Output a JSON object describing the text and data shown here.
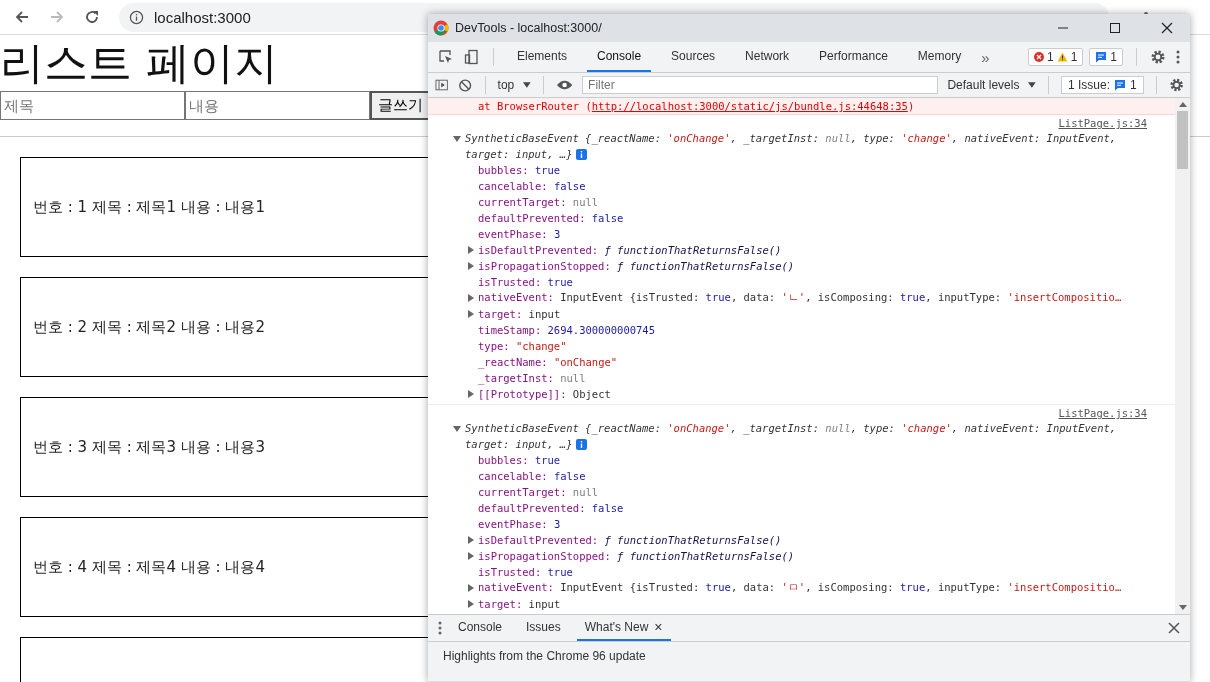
{
  "browser": {
    "address": "localhost:3000",
    "back_disabled": false,
    "forward_disabled": true
  },
  "page": {
    "title": "리스트 페이지",
    "form": {
      "title_placeholder": "제목",
      "content_placeholder": "내용",
      "submit": "글쓰기"
    },
    "posts": [
      {
        "kind": "full",
        "text": "번호 : 1 제목 : 제목1 내용 : 내용1"
      },
      {
        "kind": "full",
        "text": "번호 : 2 제목 : 제목2 내용 : 내용2"
      },
      {
        "kind": "full",
        "text": "번호 : 3 제목 : 제목3 내용 : 내용3"
      },
      {
        "kind": "full",
        "text": "번호 : 4 제목 : 제목4 내용 : 내용4"
      },
      {
        "kind": "cut_off"
      }
    ]
  },
  "devtools": {
    "title": "DevTools - localhost:3000/",
    "tabs": [
      {
        "label": "Elements",
        "selected": false
      },
      {
        "label": "Console",
        "selected": true
      },
      {
        "label": "Sources",
        "selected": false
      },
      {
        "label": "Network",
        "selected": false
      },
      {
        "label": "Performance",
        "selected": false
      },
      {
        "label": "Memory",
        "selected": false
      }
    ],
    "more_tabs": "»",
    "counters": {
      "errors": "1",
      "warnings": "1",
      "messages": "1"
    },
    "console_toolbar": {
      "context": "top",
      "filter_placeholder": "Filter",
      "levels": "Default levels",
      "issues_label": "1 Issue:",
      "issues_count": "1"
    },
    "error_line": {
      "prefix": "at BrowserRouter (",
      "link": "http://localhost:3000/static/js/bundle.js:44648:35",
      "suffix": ")"
    },
    "events": [
      {
        "source": "ListPage.js:34",
        "expanded": true,
        "header": [
          {
            "text": "SyntheticBaseEvent {_reactName: ",
            "kind": "plain"
          },
          {
            "text": "'onChange'",
            "kind": "string"
          },
          {
            "text": ", _targetInst: ",
            "kind": "plain"
          },
          {
            "text": "null",
            "kind": "null"
          },
          {
            "text": ", type: ",
            "kind": "plain"
          },
          {
            "text": "'change'",
            "kind": "string"
          },
          {
            "text": ", nativeEvent: InputEvent,",
            "kind": "plain"
          }
        ],
        "header_cont": "target: input, …}",
        "props": [
          {
            "key": "bubbles:",
            "expandable": false,
            "value": [
              {
                "text": "true",
                "kind": "keyword"
              }
            ]
          },
          {
            "key": "cancelable:",
            "expandable": false,
            "value": [
              {
                "text": "false",
                "kind": "keyword"
              }
            ]
          },
          {
            "key": "currentTarget:",
            "expandable": false,
            "value": [
              {
                "text": "null",
                "kind": "null"
              }
            ]
          },
          {
            "key": "defaultPrevented:",
            "expandable": false,
            "value": [
              {
                "text": "false",
                "kind": "keyword"
              }
            ]
          },
          {
            "key": "eventPhase:",
            "expandable": false,
            "value": [
              {
                "text": "3",
                "kind": "keyword"
              }
            ]
          },
          {
            "key": "isDefaultPrevented:",
            "expandable": true,
            "value": [
              {
                "text": "ƒ functionThatReturnsFalse()",
                "kind": "function"
              }
            ]
          },
          {
            "key": "isPropagationStopped:",
            "expandable": true,
            "value": [
              {
                "text": "ƒ functionThatReturnsFalse()",
                "kind": "function"
              }
            ]
          },
          {
            "key": "isTrusted:",
            "expandable": false,
            "value": [
              {
                "text": "true",
                "kind": "keyword"
              }
            ]
          },
          {
            "key": "nativeEvent:",
            "expandable": true,
            "value": [
              {
                "text": "InputEvent {isTrusted: ",
                "kind": "plain"
              },
              {
                "text": "true",
                "kind": "keyword"
              },
              {
                "text": ", data: ",
                "kind": "plain"
              },
              {
                "text": "'ㄴ'",
                "kind": "string"
              },
              {
                "text": ", isComposing: ",
                "kind": "plain"
              },
              {
                "text": "true",
                "kind": "keyword"
              },
              {
                "text": ", inputType: ",
                "kind": "plain"
              },
              {
                "text": "'insertCompositio…",
                "kind": "string"
              }
            ]
          },
          {
            "key": "target:",
            "expandable": true,
            "value": [
              {
                "text": "input",
                "kind": "plain"
              }
            ]
          },
          {
            "key": "timeStamp:",
            "expandable": false,
            "value": [
              {
                "text": "2694.300000000745",
                "kind": "keyword"
              }
            ]
          },
          {
            "key": "type:",
            "expandable": false,
            "value": [
              {
                "text": "\"change\"",
                "kind": "string"
              }
            ]
          },
          {
            "key": "_reactName:",
            "expandable": false,
            "value": [
              {
                "text": "\"onChange\"",
                "kind": "string"
              }
            ]
          },
          {
            "key": "_targetInst:",
            "expandable": false,
            "value": [
              {
                "text": "null",
                "kind": "null"
              }
            ]
          },
          {
            "key": "[[Prototype]]:",
            "expandable": true,
            "value": [
              {
                "text": "Object",
                "kind": "plain"
              }
            ]
          }
        ]
      },
      {
        "source": "ListPage.js:34",
        "expanded": true,
        "header": [
          {
            "text": "SyntheticBaseEvent {_reactName: ",
            "kind": "plain"
          },
          {
            "text": "'onChange'",
            "kind": "string"
          },
          {
            "text": ", _targetInst: ",
            "kind": "plain"
          },
          {
            "text": "null",
            "kind": "null"
          },
          {
            "text": ", type: ",
            "kind": "plain"
          },
          {
            "text": "'change'",
            "kind": "string"
          },
          {
            "text": ", nativeEvent: InputEvent,",
            "kind": "plain"
          }
        ],
        "header_cont": "target: input, …}",
        "props": [
          {
            "key": "bubbles:",
            "expandable": false,
            "value": [
              {
                "text": "true",
                "kind": "keyword"
              }
            ]
          },
          {
            "key": "cancelable:",
            "expandable": false,
            "value": [
              {
                "text": "false",
                "kind": "keyword"
              }
            ]
          },
          {
            "key": "currentTarget:",
            "expandable": false,
            "value": [
              {
                "text": "null",
                "kind": "null"
              }
            ]
          },
          {
            "key": "defaultPrevented:",
            "expandable": false,
            "value": [
              {
                "text": "false",
                "kind": "keyword"
              }
            ]
          },
          {
            "key": "eventPhase:",
            "expandable": false,
            "value": [
              {
                "text": "3",
                "kind": "keyword"
              }
            ]
          },
          {
            "key": "isDefaultPrevented:",
            "expandable": true,
            "value": [
              {
                "text": "ƒ functionThatReturnsFalse()",
                "kind": "function"
              }
            ]
          },
          {
            "key": "isPropagationStopped:",
            "expandable": true,
            "value": [
              {
                "text": "ƒ functionThatReturnsFalse()",
                "kind": "function"
              }
            ]
          },
          {
            "key": "isTrusted:",
            "expandable": false,
            "value": [
              {
                "text": "true",
                "kind": "keyword"
              }
            ]
          },
          {
            "key": "nativeEvent:",
            "expandable": true,
            "value": [
              {
                "text": "InputEvent {isTrusted: ",
                "kind": "plain"
              },
              {
                "text": "true",
                "kind": "keyword"
              },
              {
                "text": ", data: ",
                "kind": "plain"
              },
              {
                "text": "'ㅁ'",
                "kind": "string"
              },
              {
                "text": ", isComposing: ",
                "kind": "plain"
              },
              {
                "text": "true",
                "kind": "keyword"
              },
              {
                "text": ", inputType: ",
                "kind": "plain"
              },
              {
                "text": "'insertCompositio…",
                "kind": "string"
              }
            ]
          },
          {
            "key": "target:",
            "expandable": true,
            "value": [
              {
                "text": "input",
                "kind": "plain"
              }
            ]
          }
        ]
      }
    ],
    "drawer": {
      "tabs": [
        {
          "label": "Console",
          "selected": false,
          "closable": false
        },
        {
          "label": "Issues",
          "selected": false,
          "closable": false
        },
        {
          "label": "What's New",
          "selected": true,
          "closable": true
        }
      ],
      "close": "×",
      "content": "Highlights from the Chrome 96 update"
    }
  }
}
